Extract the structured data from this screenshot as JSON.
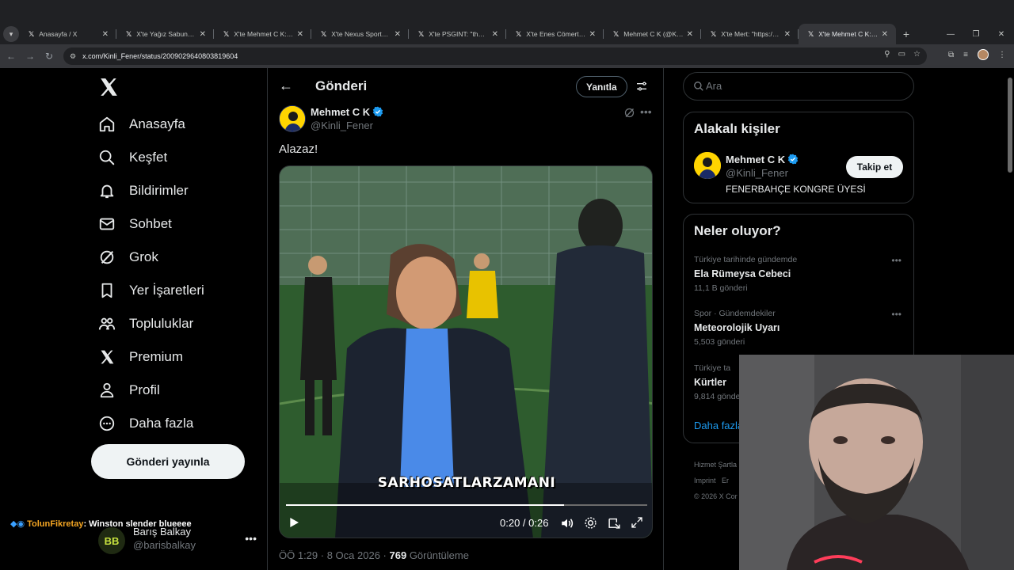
{
  "browser": {
    "tabs": [
      {
        "title": "Anasayfa / X",
        "active": false
      },
      {
        "title": "X'te Yağız Sabuncuoğ",
        "active": false
      },
      {
        "title": "X'te Mehmet C K: \"M",
        "active": false
      },
      {
        "title": "X'te Nexus Sports: \"M",
        "active": false
      },
      {
        "title": "X'te PSGINT: \"the M",
        "active": false
      },
      {
        "title": "X'te Enes Cömert: \"M",
        "active": false
      },
      {
        "title": "Mehmet C K (@Kinli_",
        "active": false
      },
      {
        "title": "X'te Mert: \"https://t.c",
        "active": false
      },
      {
        "title": "X'te Mehmet C K: \"Al",
        "active": true
      }
    ],
    "url": "x.com/Kinli_Fener/status/2009029640803819604"
  },
  "sidebar": {
    "items": [
      {
        "label": "Anasayfa",
        "icon": "home-icon"
      },
      {
        "label": "Keşfet",
        "icon": "search-icon"
      },
      {
        "label": "Bildirimler",
        "icon": "bell-icon"
      },
      {
        "label": "Sohbet",
        "icon": "mail-icon"
      },
      {
        "label": "Grok",
        "icon": "grok-icon"
      },
      {
        "label": "Yer İşaretleri",
        "icon": "bookmark-icon"
      },
      {
        "label": "Topluluklar",
        "icon": "communities-icon"
      },
      {
        "label": "Premium",
        "icon": "x-logo-icon"
      },
      {
        "label": "Profil",
        "icon": "person-icon"
      },
      {
        "label": "Daha fazla",
        "icon": "more-circle-icon"
      }
    ],
    "post_button": "Gönderi yayınla",
    "account": {
      "name": "Barış Balkay",
      "handle": "@barisbalkay",
      "avatar_text": "BB"
    }
  },
  "chat_overlay": {
    "user": "TolunFikretay",
    "message": ": Winston slender blueeee"
  },
  "main": {
    "header_title": "Gönderi",
    "reply_label": "Yanıtla",
    "author": {
      "name": "Mehmet C K",
      "handle": "@Kinli_Fener"
    },
    "tweet_text": "Alazaz!",
    "video": {
      "caption": "SARHOSATLARZAMANI",
      "current_time": "0:20",
      "duration": "0:26",
      "time_display": "0:20 / 0:26",
      "progress": 0.77
    },
    "meta": {
      "time": "ÖÖ 1:29",
      "date": "8 Oca 2026",
      "views": "769",
      "views_label": "Görüntüleme"
    }
  },
  "right": {
    "search_placeholder": "Ara",
    "relevant": {
      "title": "Alakalı kişiler",
      "name": "Mehmet C K",
      "handle": "@Kinli_Fener",
      "bio": "FENERBAHÇE KONGRE ÜYESİ",
      "follow_label": "Takip et"
    },
    "trends": {
      "title": "Neler oluyor?",
      "items": [
        {
          "context": "Türkiye tarihinde gündemde",
          "name": "Ela Rümeysa Cebeci",
          "count": "11,1 B gönderi"
        },
        {
          "context": "Spor · Gündemdekiler",
          "name": "Meteorolojik Uyarı",
          "count": "5,503 gönderi"
        },
        {
          "context": "Türkiye ta",
          "name": "Kürtler",
          "count": "9,814 gönde"
        }
      ],
      "show_more": "Daha fazla"
    },
    "footer": {
      "line1": "Hizmet Şartla",
      "line2a": "Imprint",
      "line2b": "Er",
      "line3": "© 2026 X Cor"
    }
  },
  "colors": {
    "accent": "#1d9bf0",
    "background": "#000000",
    "text": "#e7e9ea",
    "muted": "#71767b",
    "border": "#2f3336"
  }
}
